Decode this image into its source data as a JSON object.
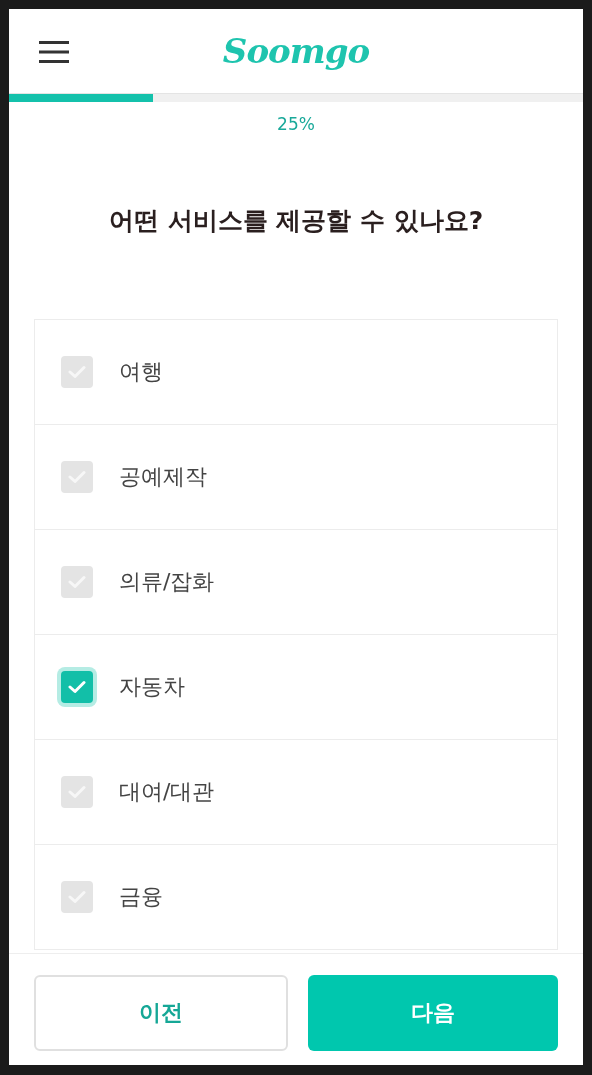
{
  "header": {
    "logo": "Soomgo"
  },
  "progress": {
    "level": 0.25,
    "label": "25%"
  },
  "question": "어떤 서비스를 제공할 수 있나요?",
  "options": [
    {
      "label": "여행",
      "checked": false
    },
    {
      "label": "공예제작",
      "checked": false
    },
    {
      "label": "의류/잡화",
      "checked": false
    },
    {
      "label": "자동차",
      "checked": true
    },
    {
      "label": "대여/대관",
      "checked": false
    },
    {
      "label": "금융",
      "checked": false
    }
  ],
  "buttons": [
    {
      "label": "이전",
      "kind": "secondary"
    },
    {
      "label": "다음",
      "kind": "primary"
    }
  ]
}
